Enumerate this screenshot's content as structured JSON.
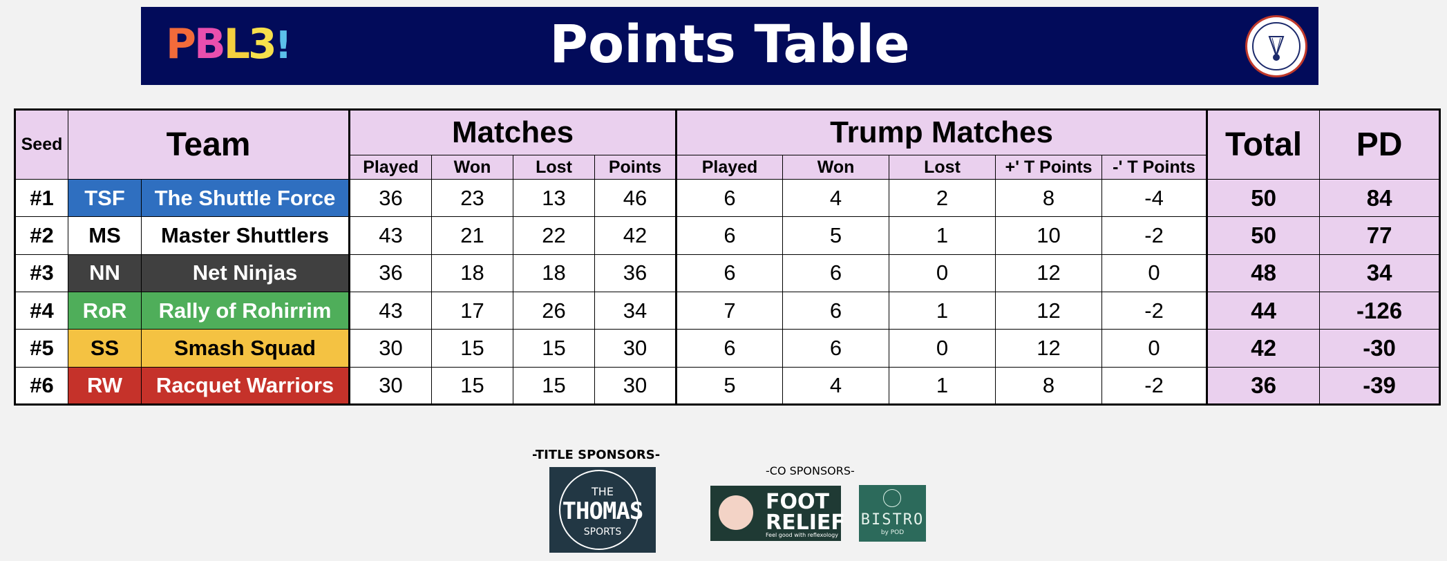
{
  "banner": {
    "logo": {
      "p": "P",
      "b": "B",
      "l": "L",
      "n": "3",
      "ex": "!"
    },
    "title": "Points Table"
  },
  "table": {
    "headers": {
      "seed": "Seed",
      "team": "Team",
      "matches": "Matches",
      "trump_matches": "Trump Matches",
      "total": "Total",
      "pd": "PD",
      "matches_sub": [
        "Played",
        "Won",
        "Lost",
        "Points"
      ],
      "trump_sub": [
        "Played",
        "Won",
        "Lost",
        "+' T Points",
        "-' T Points"
      ]
    },
    "rows": [
      {
        "seed": "#1",
        "abbr": "TSF",
        "name": "The Shuttle Force",
        "color": "#2f6fc0",
        "text_color": "#ffffff",
        "m_played": "36",
        "m_won": "23",
        "m_lost": "13",
        "m_points": "46",
        "t_played": "6",
        "t_won": "4",
        "t_lost": "2",
        "t_plus": "8",
        "t_minus": "-4",
        "total": "50",
        "pd": "84"
      },
      {
        "seed": "#2",
        "abbr": "MS",
        "name": "Master Shuttlers",
        "color": "#ffffff",
        "text_color": "#000000",
        "m_played": "43",
        "m_won": "21",
        "m_lost": "22",
        "m_points": "42",
        "t_played": "6",
        "t_won": "5",
        "t_lost": "1",
        "t_plus": "10",
        "t_minus": "-2",
        "total": "50",
        "pd": "77"
      },
      {
        "seed": "#3",
        "abbr": "NN",
        "name": "Net Ninjas",
        "color": "#404040",
        "text_color": "#ffffff",
        "m_played": "36",
        "m_won": "18",
        "m_lost": "18",
        "m_points": "36",
        "t_played": "6",
        "t_won": "6",
        "t_lost": "0",
        "t_plus": "12",
        "t_minus": "0",
        "total": "48",
        "pd": "34"
      },
      {
        "seed": "#4",
        "abbr": "RoR",
        "name": "Rally of Rohirrim",
        "color": "#4fae5a",
        "text_color": "#ffffff",
        "m_played": "43",
        "m_won": "17",
        "m_lost": "26",
        "m_points": "34",
        "t_played": "7",
        "t_won": "6",
        "t_lost": "1",
        "t_plus": "12",
        "t_minus": "-2",
        "total": "44",
        "pd": "-126"
      },
      {
        "seed": "#5",
        "abbr": "SS",
        "name": "Smash Squad",
        "color": "#f4c242",
        "text_color": "#000000",
        "m_played": "30",
        "m_won": "15",
        "m_lost": "15",
        "m_points": "30",
        "t_played": "6",
        "t_won": "6",
        "t_lost": "0",
        "t_plus": "12",
        "t_minus": "0",
        "total": "42",
        "pd": "-30"
      },
      {
        "seed": "#6",
        "abbr": "RW",
        "name": "Racquet Warriors",
        "color": "#c5322a",
        "text_color": "#ffffff",
        "m_played": "30",
        "m_won": "15",
        "m_lost": "15",
        "m_points": "30",
        "t_played": "5",
        "t_won": "4",
        "t_lost": "1",
        "t_plus": "8",
        "t_minus": "-2",
        "total": "36",
        "pd": "-39"
      }
    ]
  },
  "sponsors": {
    "title_heading": "-TITLE SPONSORS-",
    "co_heading": "-CO SPONSORS-",
    "thomas": {
      "the": "THE",
      "main": "THOMAS",
      "sports": "SPORTS"
    },
    "foot": {
      "line1": "FOOT",
      "line2": "RELIEF",
      "tagline": "Feel good with reflexology"
    },
    "bistro": {
      "name": "BISTRO",
      "by": "by POD"
    }
  }
}
